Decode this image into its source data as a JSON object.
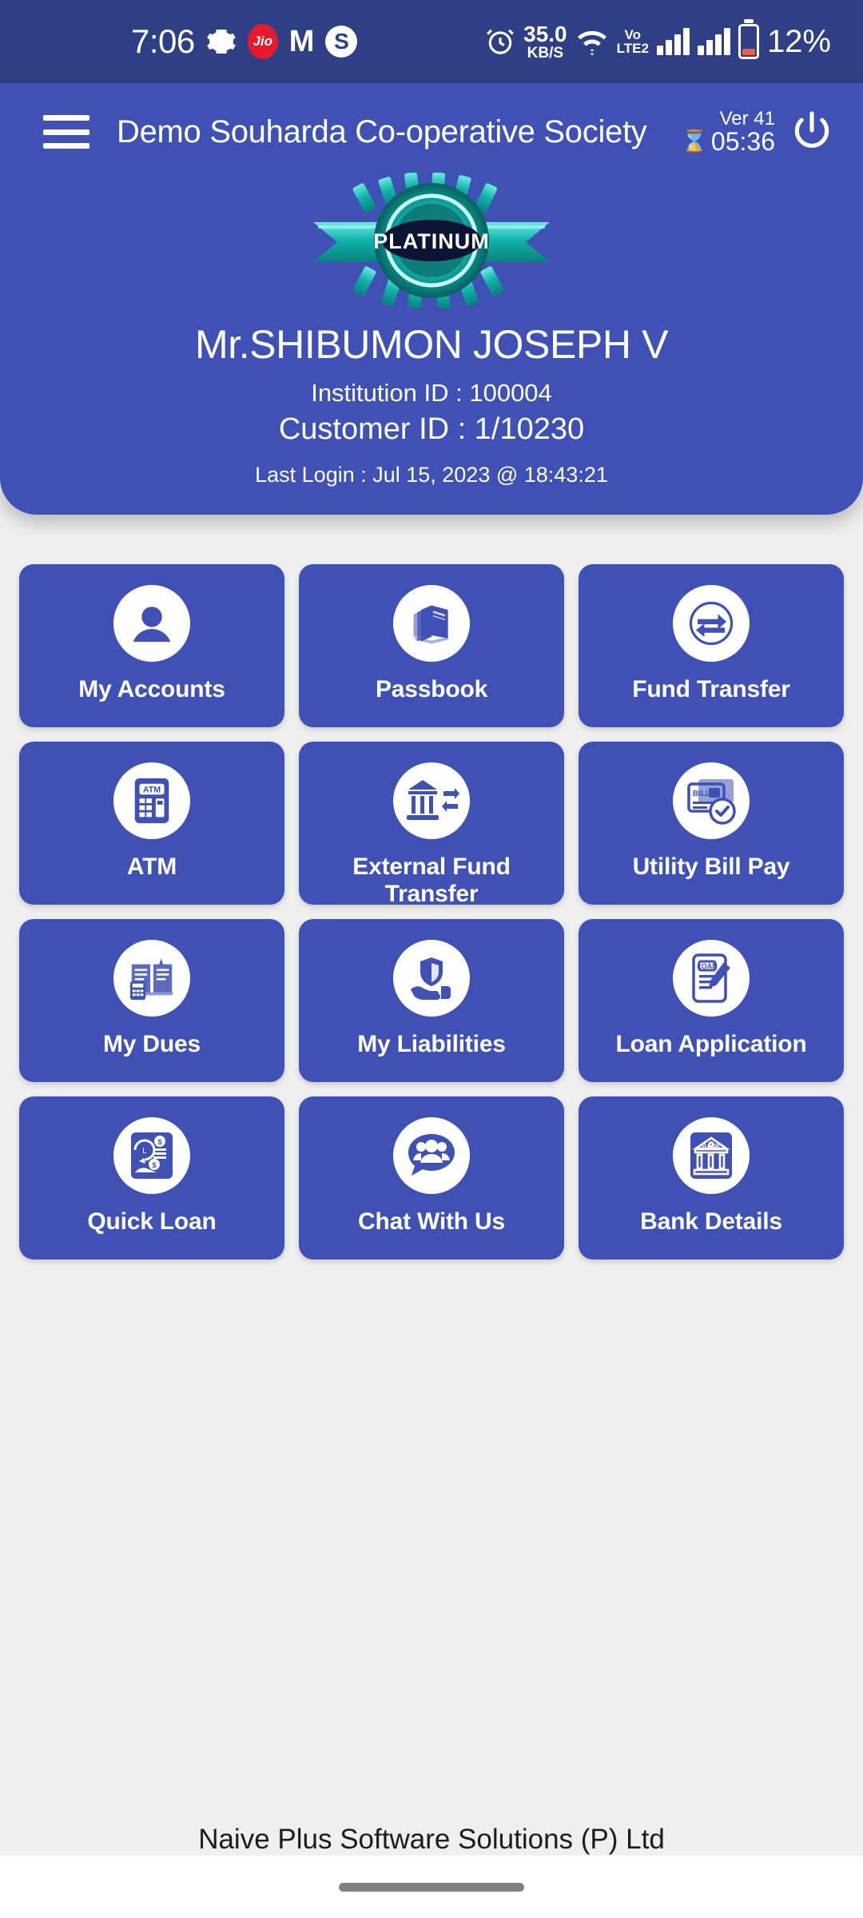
{
  "status_bar": {
    "time": "7:06",
    "icons": [
      "gear-icon",
      "jio-icon",
      "gmail-icon",
      "skype-icon",
      "alarm-icon"
    ],
    "jio_label": "Jio",
    "gmail_label": "M",
    "skype_label": "S",
    "net_speed_value": "35.0",
    "net_speed_unit": "KB/S",
    "volte_line1": "Vo",
    "volte_line2": "LTE2",
    "battery_percent": "12%"
  },
  "header": {
    "menu_icon": "hamburger-menu-icon",
    "title": "Demo Souharda Co-operative Society",
    "version": "Ver 41",
    "session_timer": "05:36",
    "hourglass_icon": "hourglass-icon",
    "power_icon": "power-icon",
    "badge_text": "PLATINUM",
    "user_name": "Mr.SHIBUMON JOSEPH V",
    "institution_id": "Institution ID : 100004",
    "customer_id": "Customer ID : 1/10230",
    "last_login": "Last Login : Jul 15, 2023 @ 18:43:21"
  },
  "colors": {
    "status_bar_bg": "#2e3f85",
    "header_bg": "#3f51b5",
    "tile_bg": "#3f51b5",
    "page_bg": "#efefef",
    "icon_circle": "#ffffff",
    "badge_teal": "#13b9b0",
    "badge_dark": "#0d1333",
    "jio_red": "#e8192c",
    "battery_orange": "#e8643c"
  },
  "menu_tiles": [
    {
      "label": "My Accounts",
      "icon": "person-icon"
    },
    {
      "label": "Passbook",
      "icon": "passbook-icon"
    },
    {
      "label": "Fund Transfer",
      "icon": "transfer-arrows-icon"
    },
    {
      "label": "ATM",
      "icon": "atm-machine-icon"
    },
    {
      "label": "External Fund Transfer",
      "icon": "bank-transfer-icon"
    },
    {
      "label": "Utility Bill Pay",
      "icon": "bill-check-icon"
    },
    {
      "label": "My Dues",
      "icon": "book-calculator-icon"
    },
    {
      "label": "My Liabilities",
      "icon": "hand-shield-icon"
    },
    {
      "label": "Loan Application",
      "icon": "loan-form-pen-icon"
    },
    {
      "label": "Quick Loan",
      "icon": "clock-money-icon"
    },
    {
      "label": "Chat With Us",
      "icon": "chat-people-icon"
    },
    {
      "label": "Bank Details",
      "icon": "bank-building-icon"
    }
  ],
  "footer": {
    "company": "Naive Plus Software Solutions (P) Ltd"
  }
}
